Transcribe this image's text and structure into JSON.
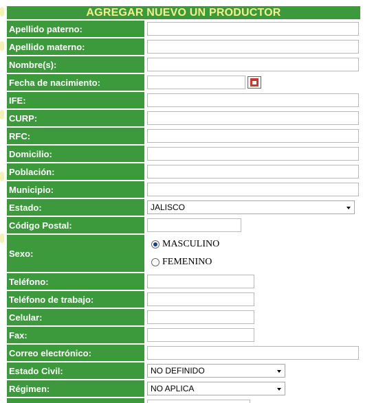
{
  "header": {
    "title": "AGREGAR NUEVO UN PRODUCTOR"
  },
  "fields": {
    "apellido_paterno": {
      "label": "Apellido paterno:",
      "value": ""
    },
    "apellido_materno": {
      "label": "Apellido materno:",
      "value": ""
    },
    "nombres": {
      "label": "Nombre(s):",
      "value": ""
    },
    "fecha_nacimiento": {
      "label": "Fecha de nacimiento:",
      "value": ""
    },
    "ife": {
      "label": "IFE:",
      "value": ""
    },
    "curp": {
      "label": "CURP:",
      "value": ""
    },
    "rfc": {
      "label": "RFC:",
      "value": ""
    },
    "domicilio": {
      "label": "Domicilio:",
      "value": ""
    },
    "poblacion": {
      "label": "Población:",
      "value": ""
    },
    "municipio": {
      "label": "Municipio:",
      "value": ""
    },
    "estado": {
      "label": "Estado:",
      "selected": "JALISCO"
    },
    "codigo_postal": {
      "label": "Código Postal:",
      "value": ""
    },
    "sexo": {
      "label": "Sexo:",
      "options": [
        "MASCULINO",
        "FEMENINO"
      ],
      "selected": "MASCULINO"
    },
    "telefono": {
      "label": "Teléfono:",
      "value": ""
    },
    "telefono_trabajo": {
      "label": "Teléfono de trabajo:",
      "value": ""
    },
    "celular": {
      "label": "Celular:",
      "value": ""
    },
    "fax": {
      "label": "Fax:",
      "value": ""
    },
    "correo": {
      "label": "Correo electrónico:",
      "value": ""
    },
    "estado_civil": {
      "label": "Estado Civil:",
      "selected": "NO DEFINIDO"
    },
    "regimen": {
      "label": "Régimen:",
      "selected": "NO APLICA"
    }
  },
  "colors": {
    "label_bg": "#3c9a3c",
    "header_text": "#f8f08a",
    "label_text": "#ffffff"
  },
  "icons": {
    "calendar": "calendar-icon"
  }
}
